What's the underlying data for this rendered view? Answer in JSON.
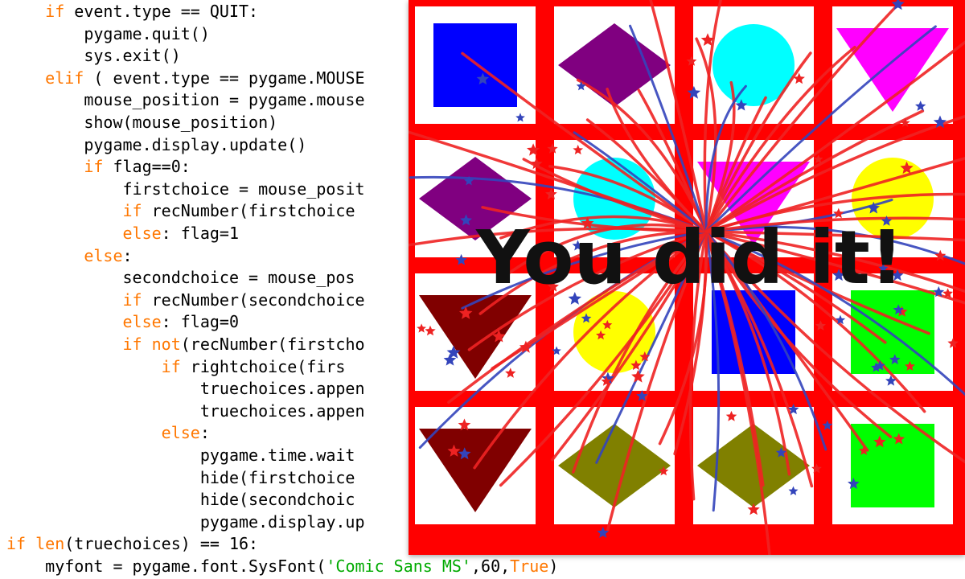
{
  "editor": {
    "language": "python",
    "colors": {
      "keyword": "#ff7700",
      "string": "#00aa00",
      "text": "#000000"
    },
    "lines": [
      [
        {
          "t": "    "
        },
        {
          "t": "if",
          "k": "kw"
        },
        {
          "t": " event.type == QUIT:"
        }
      ],
      [
        {
          "t": "        pygame.quit()"
        }
      ],
      [
        {
          "t": "        sys.exit()"
        }
      ],
      [
        {
          "t": "    "
        },
        {
          "t": "elif",
          "k": "kw"
        },
        {
          "t": " ( event.type == pygame.MOUSE"
        }
      ],
      [
        {
          "t": "        mouse_position = pygame.mouse"
        }
      ],
      [
        {
          "t": "        show(mouse_position)"
        }
      ],
      [
        {
          "t": "        pygame.display.update()"
        }
      ],
      [
        {
          "t": "        "
        },
        {
          "t": "if",
          "k": "kw"
        },
        {
          "t": " flag==0:"
        }
      ],
      [
        {
          "t": "            firstchoice = mouse_posit"
        }
      ],
      [
        {
          "t": "            "
        },
        {
          "t": "if",
          "k": "kw"
        },
        {
          "t": " recNumber(firstchoice"
        }
      ],
      [
        {
          "t": "            "
        },
        {
          "t": "else",
          "k": "kw"
        },
        {
          "t": ": flag=1"
        }
      ],
      [
        {
          "t": "        "
        },
        {
          "t": "else",
          "k": "kw"
        },
        {
          "t": ":"
        }
      ],
      [
        {
          "t": "            secondchoice = mouse_pos"
        }
      ],
      [
        {
          "t": "            "
        },
        {
          "t": "if",
          "k": "kw"
        },
        {
          "t": " recNumber(secondchoice"
        }
      ],
      [
        {
          "t": "            "
        },
        {
          "t": "else",
          "k": "kw"
        },
        {
          "t": ": flag=0"
        }
      ],
      [
        {
          "t": "            "
        },
        {
          "t": "if not",
          "k": "kw"
        },
        {
          "t": "(recNumber(firstcho"
        }
      ],
      [
        {
          "t": "                "
        },
        {
          "t": "if",
          "k": "kw"
        },
        {
          "t": " rightchoice(firs"
        }
      ],
      [
        {
          "t": "                    truechoices.appen"
        }
      ],
      [
        {
          "t": "                    truechoices.appen"
        }
      ],
      [
        {
          "t": "                "
        },
        {
          "t": "else",
          "k": "kw"
        },
        {
          "t": ":"
        }
      ],
      [
        {
          "t": "                    pygame.time.wait"
        }
      ],
      [
        {
          "t": "                    hide(firstchoice"
        }
      ],
      [
        {
          "t": "                    hide(secondchoic"
        }
      ],
      [
        {
          "t": "                    pygame.display.up"
        }
      ],
      [
        {
          "t": "if",
          "k": "kw"
        },
        {
          "t": " "
        },
        {
          "t": "len",
          "k": "kw"
        },
        {
          "t": "(truechoices) == 16:"
        }
      ],
      [
        {
          "t": "    myfont = pygame.font.SysFont("
        },
        {
          "t": "'Comic Sans MS'",
          "k": "str"
        },
        {
          "t": ",60,"
        },
        {
          "t": "True",
          "k": "kw"
        },
        {
          "t": ")"
        }
      ]
    ]
  },
  "game": {
    "message": "You did it!",
    "grid": {
      "rows": 4,
      "cols": 4,
      "border_color": "#ff0000",
      "cell_color": "#ffffff"
    },
    "cards": [
      {
        "shape": "square",
        "color": "#0000ff"
      },
      {
        "shape": "diamond",
        "color": "#800080"
      },
      {
        "shape": "circle",
        "color": "#00ffff"
      },
      {
        "shape": "triangle-down",
        "color": "#ff00ff"
      },
      {
        "shape": "diamond",
        "color": "#800080"
      },
      {
        "shape": "circle",
        "color": "#00ffff"
      },
      {
        "shape": "triangle-down",
        "color": "#ff00ff"
      },
      {
        "shape": "circle",
        "color": "#ffff00"
      },
      {
        "shape": "triangle-down",
        "color": "#800000"
      },
      {
        "shape": "circle",
        "color": "#ffff00"
      },
      {
        "shape": "square",
        "color": "#0000ff"
      },
      {
        "shape": "square",
        "color": "#00ff00"
      },
      {
        "shape": "triangle-down",
        "color": "#800000"
      },
      {
        "shape": "diamond",
        "color": "#808000"
      },
      {
        "shape": "diamond",
        "color": "#808000"
      },
      {
        "shape": "square",
        "color": "#00ff00"
      }
    ],
    "fireworks": {
      "colors": [
        "#ee2222",
        "#3344bb"
      ]
    }
  }
}
